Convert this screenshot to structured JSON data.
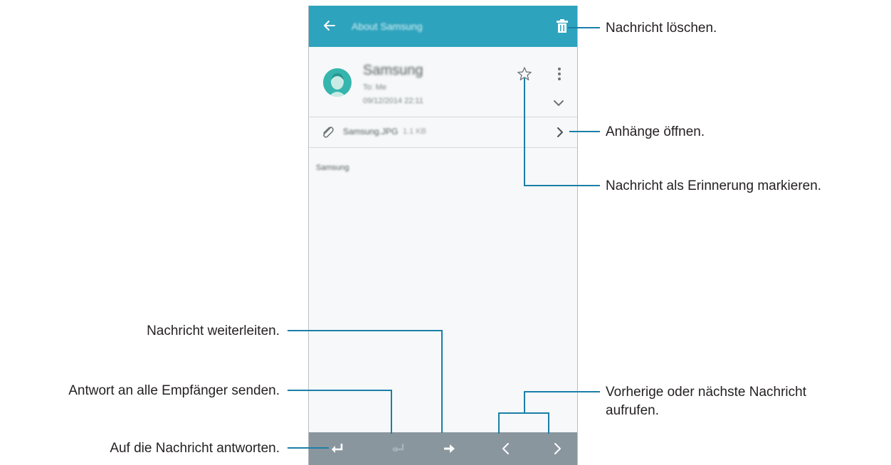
{
  "app": {
    "title": "About Samsung"
  },
  "message": {
    "sender": "Samsung",
    "to": "To: Me",
    "date": "09/12/2014 22:11",
    "attachment_name": "Samsung.JPG",
    "attachment_size": "1.1 KB",
    "body": "Samsung"
  },
  "icons": {
    "back": "back-arrow-icon",
    "delete": "trash-icon",
    "favorite": "star-icon",
    "more": "more-vertical-icon",
    "expand": "chevron-down-icon",
    "attachment": "paperclip-icon",
    "open_attachment": "chevron-right-icon",
    "reply": "reply-icon",
    "reply_all": "reply-all-icon",
    "forward": "forward-icon",
    "previous": "chevron-left-icon",
    "next": "chevron-right-icon"
  },
  "colors": {
    "appbar": "#2ea3bd",
    "bottombar": "#8a969d",
    "avatar": "#35b5ad",
    "callout": "#1a7fa8"
  },
  "callouts": {
    "delete": "Nachricht löschen.",
    "attachments": "Anhänge öffnen.",
    "mark": "Nachricht als Erinnerung markieren.",
    "forward": "Nachricht weiterleiten.",
    "reply_all": "Antwort an alle Empfänger senden.",
    "reply": "Auf die Nachricht antworten.",
    "prev_next_line1": "Vorherige oder nächste Nachricht",
    "prev_next_line2": "aufrufen."
  }
}
